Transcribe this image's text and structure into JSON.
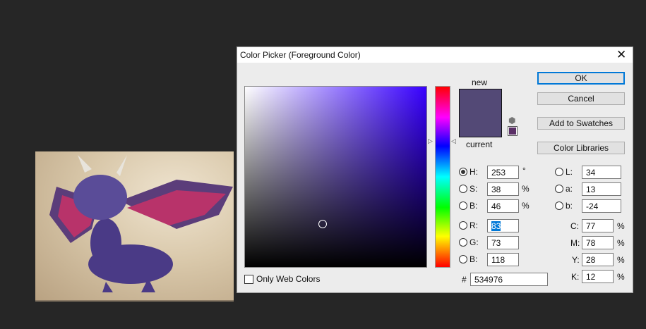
{
  "dialog": {
    "title": "Color Picker (Foreground Color)",
    "close": "✕"
  },
  "swatch": {
    "new_label": "new",
    "current_label": "current",
    "new_color": "#534976",
    "current_color": "#5a2f66"
  },
  "buttons": {
    "ok": "OK",
    "cancel": "Cancel",
    "add_swatches": "Add to Swatches",
    "libraries": "Color Libraries"
  },
  "hsb": {
    "h_label": "H:",
    "h": "253",
    "h_unit": "°",
    "s_label": "S:",
    "s": "38",
    "s_unit": "%",
    "b_label": "B:",
    "b": "46",
    "b_unit": "%"
  },
  "rgb": {
    "r_label": "R:",
    "r": "83",
    "g_label": "G:",
    "g": "73",
    "b_label": "B:",
    "b": "118"
  },
  "lab": {
    "l_label": "L:",
    "l": "34",
    "a_label": "a:",
    "a": "13",
    "b_label": "b:",
    "b": "-24"
  },
  "cmyk": {
    "c_label": "C:",
    "c": "77",
    "m_label": "M:",
    "m": "78",
    "y_label": "Y:",
    "y": "28",
    "k_label": "K:",
    "k": "12",
    "unit": "%"
  },
  "hex": {
    "label": "#",
    "value": "534976"
  },
  "web_only": {
    "label": "Only Web Colors",
    "checked": false
  }
}
